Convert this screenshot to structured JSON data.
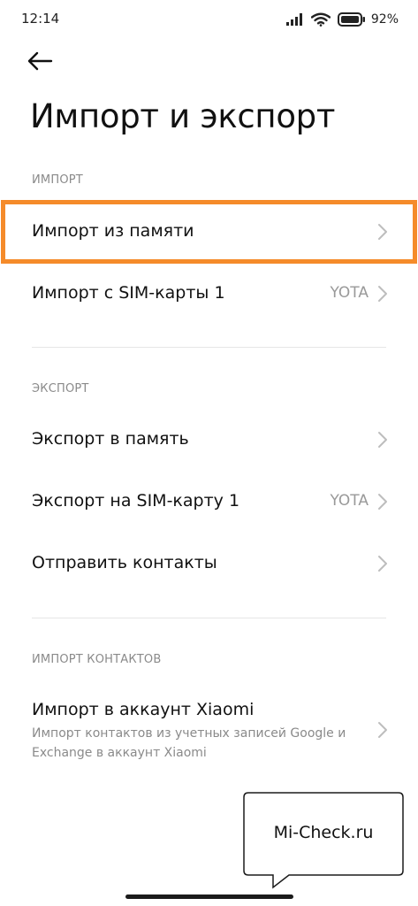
{
  "status_bar": {
    "time": "12:14",
    "battery_percent": "92%",
    "icons": [
      "signal-icon",
      "wifi-icon",
      "battery-icon"
    ]
  },
  "header": {
    "back_icon": "arrow-left-icon",
    "title": "Импорт и экспорт"
  },
  "sections": {
    "import": {
      "header": "ИМПОРТ",
      "items": [
        {
          "label": "Импорт из памяти",
          "value": ""
        },
        {
          "label": "Импорт с SIM-карты 1",
          "value": "YOTA"
        }
      ]
    },
    "export": {
      "header": "ЭКСПОРТ",
      "items": [
        {
          "label": "Экспорт в память",
          "value": ""
        },
        {
          "label": "Экспорт на SIM-карту 1",
          "value": "YOTA"
        },
        {
          "label": "Отправить контакты",
          "value": ""
        }
      ]
    },
    "import_contacts": {
      "header": "ИМПОРТ КОНТАКТОВ",
      "items": [
        {
          "label": "Импорт в аккаунт Xiaomi",
          "subtitle": "Импорт контактов из учетных записей Google и Exchange в аккаунт Xiaomi"
        }
      ]
    }
  },
  "highlight_color": "#f58b2a",
  "watermark": "Mi-Check.ru"
}
